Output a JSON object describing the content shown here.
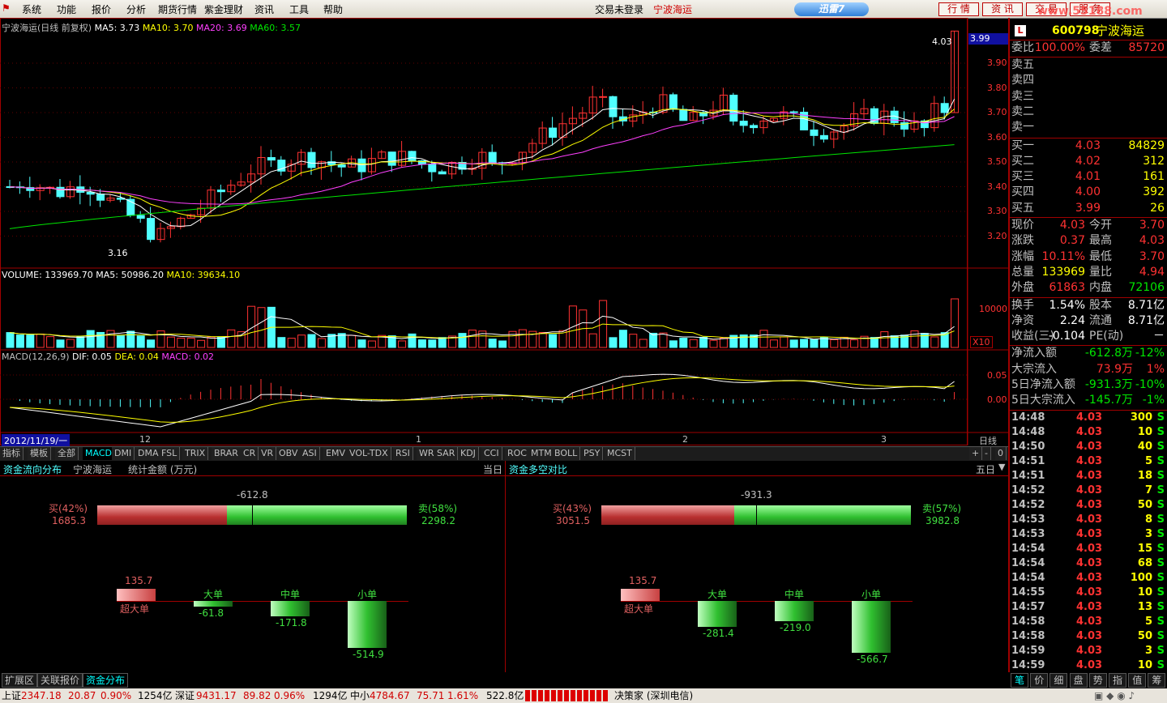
{
  "menu": [
    "系统",
    "功能",
    "报价",
    "分析",
    "期货行情",
    "紫金理财",
    "资讯",
    "工具",
    "帮助"
  ],
  "status": {
    "login": "交易未登录",
    "stock": "宁波海运"
  },
  "xunlei": "迅雷7",
  "top_buttons": [
    "行 情",
    "资 讯",
    "交 易",
    "服 务"
  ],
  "watermark": "www.55188.com",
  "kline": {
    "title": "宁波海运(日线 前复权)",
    "ma5": "MA5: 3.73",
    "ma10": "MA10: 3.70",
    "ma20": "MA20: 3.69",
    "ma60": "MA60: 3.57",
    "high_mark": "4.03",
    "low_mark": "3.16",
    "price_tag": "3.99",
    "yaxis": [
      "3.90",
      "3.80",
      "3.70",
      "3.60",
      "3.50",
      "3.40",
      "3.30",
      "3.20"
    ],
    "colors": {
      "up": "#ff3232",
      "down": "#50ffff",
      "ma5": "#ffffff",
      "ma10": "#ffff00",
      "ma20": "#ff40ff",
      "ma60": "#00e600"
    }
  },
  "volume": {
    "label": "VOLUME: 133969.70",
    "ma5": "MA5: 50986.20",
    "ma10": "MA10: 39634.10",
    "yaxis": "10000",
    "unit": "X10"
  },
  "macd": {
    "label": "MACD(12,26,9)",
    "dif": "DIF: 0.05",
    "dea": "DEA: 0.04",
    "macd": "MACD: 0.02",
    "yaxis": [
      "0.05",
      "0.00"
    ]
  },
  "timeaxis": {
    "date": "2012/11/19/一",
    "months": [
      "12",
      "1",
      "2",
      "3"
    ],
    "period": "日线"
  },
  "ind_tabs": [
    "指标",
    "模板",
    "全部",
    "MACD",
    "DMI",
    "DMA",
    "FSL",
    "TRIX",
    "BRAR",
    "CR",
    "VR",
    "OBV",
    "ASI",
    "EMV",
    "VOL-TDX",
    "RSI",
    "WR",
    "SAR",
    "KDJ",
    "CCI",
    "ROC",
    "MTM",
    "BOLL",
    "PSY",
    "MCST"
  ],
  "ind_tab_controls": [
    "+",
    "-",
    "0"
  ],
  "flow_left": {
    "title": "资金流向分布",
    "stock": "宁波海运",
    "unit": "统计金额 (万元)",
    "period": "当日",
    "net": "-612.8",
    "buy_label": "买(42%)",
    "buy_val": "1685.3",
    "sell_label": "卖(58%)",
    "sell_val": "2298.2",
    "buy_pct": 42,
    "orders": [
      {
        "name": "超大单",
        "val": "135.7",
        "num": 135.7
      },
      {
        "name": "大单",
        "val": "-61.8",
        "num": -61.8
      },
      {
        "name": "中单",
        "val": "-171.8",
        "num": -171.8
      },
      {
        "name": "小单",
        "val": "-514.9",
        "num": -514.9
      }
    ]
  },
  "flow_right": {
    "title": "资金多空对比",
    "period": "五日",
    "net": "-931.3",
    "buy_label": "买(43%)",
    "buy_val": "3051.5",
    "sell_label": "卖(57%)",
    "sell_val": "3982.8",
    "buy_pct": 43,
    "orders": [
      {
        "name": "超大单",
        "val": "135.7",
        "num": 135.7
      },
      {
        "name": "大单",
        "val": "-281.4",
        "num": -281.4
      },
      {
        "name": "中单",
        "val": "-219.0",
        "num": -219.0
      },
      {
        "name": "小单",
        "val": "-566.7",
        "num": -566.7
      }
    ]
  },
  "quote": {
    "code": "600798",
    "name": "宁波海运",
    "flag": "L",
    "weibi": {
      "k": "委比",
      "v": "100.00%",
      "k2": "委差",
      "v2": "85720"
    },
    "sells": [
      "卖五",
      "卖四",
      "卖三",
      "卖二",
      "卖一"
    ],
    "buys": [
      {
        "k": "买一",
        "p": "4.03",
        "v": "84829"
      },
      {
        "k": "买二",
        "p": "4.02",
        "v": "312"
      },
      {
        "k": "买三",
        "p": "4.01",
        "v": "161"
      },
      {
        "k": "买四",
        "p": "4.00",
        "v": "392"
      },
      {
        "k": "买五",
        "p": "3.99",
        "v": "26"
      }
    ],
    "stats": [
      {
        "k": "现价",
        "v": "4.03",
        "k2": "今开",
        "v2": "3.70"
      },
      {
        "k": "涨跌",
        "v": "0.37",
        "k2": "最高",
        "v2": "4.03"
      },
      {
        "k": "涨幅",
        "v": "10.11%",
        "k2": "最低",
        "v2": "3.70"
      },
      {
        "k": "总量",
        "v": "133969",
        "k2": "量比",
        "v2": "4.94"
      },
      {
        "k": "外盘",
        "v": "61863",
        "k2": "内盘",
        "v2": "72106"
      }
    ],
    "stats2": [
      {
        "k": "换手",
        "v": "1.54%",
        "k2": "股本",
        "v2": "8.71亿"
      },
      {
        "k": "净资",
        "v": "2.24",
        "k2": "流通",
        "v2": "8.71亿"
      },
      {
        "k": "收益(三)",
        "v": "-0.104",
        "k2": "PE(动)",
        "v2": "－"
      }
    ],
    "flows": [
      {
        "k": "净流入额",
        "v": "-612.8万",
        "p": "-12%"
      },
      {
        "k": "大宗流入",
        "v": "73.9万",
        "p": "1%"
      },
      {
        "k": "5日净流入额",
        "v": "-931.3万",
        "p": "-10%"
      },
      {
        "k": "5日大宗流入",
        "v": "-145.7万",
        "p": "-1%"
      }
    ],
    "ticks": [
      [
        "14:48",
        "4.03",
        "300",
        "S"
      ],
      [
        "14:48",
        "4.03",
        "10",
        "S"
      ],
      [
        "14:50",
        "4.03",
        "40",
        "S"
      ],
      [
        "14:51",
        "4.03",
        "5",
        "S"
      ],
      [
        "14:51",
        "4.03",
        "18",
        "S"
      ],
      [
        "14:52",
        "4.03",
        "7",
        "S"
      ],
      [
        "14:52",
        "4.03",
        "50",
        "S"
      ],
      [
        "14:53",
        "4.03",
        "8",
        "S"
      ],
      [
        "14:53",
        "4.03",
        "3",
        "S"
      ],
      [
        "14:54",
        "4.03",
        "15",
        "S"
      ],
      [
        "14:54",
        "4.03",
        "68",
        "S"
      ],
      [
        "14:54",
        "4.03",
        "100",
        "S"
      ],
      [
        "14:55",
        "4.03",
        "10",
        "S"
      ],
      [
        "14:57",
        "4.03",
        "13",
        "S"
      ],
      [
        "14:58",
        "4.03",
        "5",
        "S"
      ],
      [
        "14:58",
        "4.03",
        "50",
        "S"
      ],
      [
        "14:59",
        "4.03",
        "3",
        "S"
      ],
      [
        "14:59",
        "4.03",
        "10",
        "S"
      ]
    ],
    "tabs": [
      "笔",
      "价",
      "细",
      "盘",
      "势",
      "指",
      "值",
      "筹"
    ]
  },
  "bottom_tabs": [
    "扩展区",
    "关联报价",
    "资金分布"
  ],
  "ticker": [
    {
      "name": "上证",
      "idx": "2347.18",
      "chg": "20.87",
      "pct": "0.90%",
      "amt": "1254亿"
    },
    {
      "name": "深证",
      "idx": "9431.17",
      "chg": "89.82",
      "pct": "0.96%",
      "amt": "1294亿"
    },
    {
      "name": "中小",
      "idx": "4784.67",
      "chg": "75.71",
      "pct": "1.61%",
      "amt": "522.8亿"
    }
  ],
  "broker": "决策家 (深圳电信)"
}
